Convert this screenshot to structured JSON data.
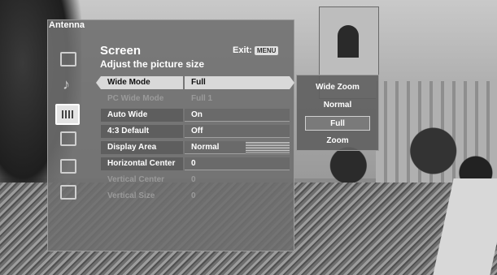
{
  "panel": {
    "label": "Antenna"
  },
  "header": {
    "title": "Screen",
    "subtitle": "Adjust the picture size",
    "exit_label": "Exit:",
    "exit_badge": "MENU"
  },
  "sidebar": {
    "icons": [
      "antenna-icon",
      "music-note-icon",
      "screen-icon",
      "picture-icon",
      "video-setup-icon",
      "list-icon"
    ]
  },
  "settings": [
    {
      "label": "Wide Mode",
      "value": "Full"
    },
    {
      "label": "PC Wide Mode",
      "value": "Full 1"
    },
    {
      "label": "Auto Wide",
      "value": "On"
    },
    {
      "label": "4:3 Default",
      "value": "Off"
    },
    {
      "label": "Display Area",
      "value": "Normal"
    },
    {
      "label": "Horizontal Center",
      "value": "0"
    },
    {
      "label": "Vertical Center",
      "value": "0"
    },
    {
      "label": "Vertical Size",
      "value": "0"
    }
  ],
  "options": {
    "items": [
      "Wide Zoom",
      "Normal",
      "Full",
      "Zoom"
    ],
    "selected": "Full"
  }
}
